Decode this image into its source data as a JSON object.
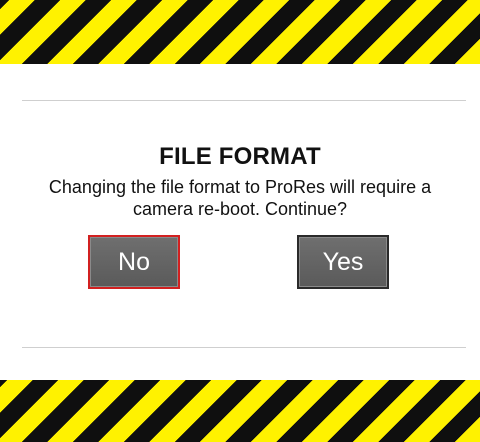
{
  "dialog": {
    "title": "FILE FORMAT",
    "message": "Changing the file format to ProRes will require a camera re-boot. Continue?",
    "buttons": {
      "no_label": "No",
      "yes_label": "Yes"
    }
  },
  "colors": {
    "hazard_yellow": "#fff200",
    "hazard_black": "#0f0f0f",
    "button_gray": "#5f5f5f",
    "focus_red": "#d22020"
  }
}
